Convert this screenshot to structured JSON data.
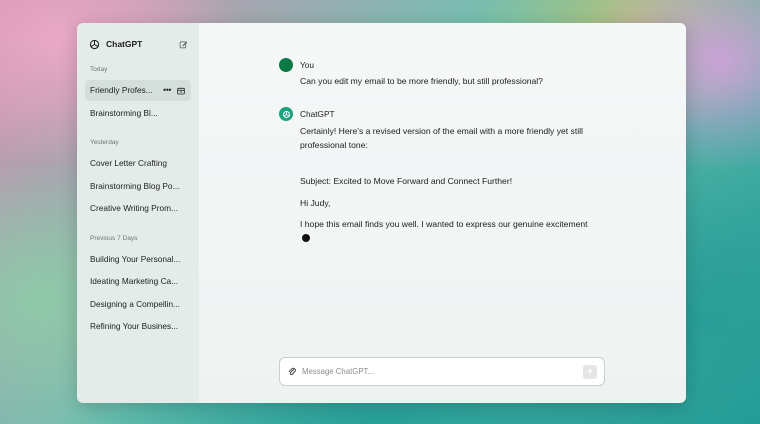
{
  "app": {
    "title": "ChatGPT"
  },
  "sidebar": {
    "sections": [
      {
        "label": "Today",
        "items": [
          "Friendly Profes...",
          "Brainstorming Bl..."
        ]
      },
      {
        "label": "Yesterday",
        "items": [
          "Cover Letter Crafting",
          "Brainstorming Blog Po...",
          "Creative Writing Prom..."
        ]
      },
      {
        "label": "Previous 7 Days",
        "items": [
          "Building Your Personal...",
          "Ideating Marketing Ca...",
          "Designing a Compellin...",
          "Refining Your Busines..."
        ]
      }
    ],
    "active_item_dots": "•••",
    "icons": {
      "logo": "openai-logo-icon",
      "new_chat": "edit-icon",
      "archive": "archive-icon",
      "more": "more-dots-icon"
    }
  },
  "conversation": {
    "user": {
      "name": "You",
      "text": "Can you edit my email to be more friendly, but still professional?"
    },
    "assistant": {
      "name": "ChatGPT",
      "intro": "Certainly! Here's a revised version of the email with a more friendly yet still professional tone:",
      "subject": "Subject: Excited to Move Forward and Connect Further!",
      "greeting": "Hi Judy,",
      "body": "I hope this email finds you well. I wanted to express our genuine excitement"
    }
  },
  "composer": {
    "placeholder": "Message ChatGPT...",
    "icons": {
      "attach": "paperclip-icon",
      "send": "send-arrow-icon"
    }
  },
  "colors": {
    "sidebar_bg": "#e4ecea",
    "user_avatar": "#0b7a45",
    "assistant_avatar": "#19a37f"
  }
}
